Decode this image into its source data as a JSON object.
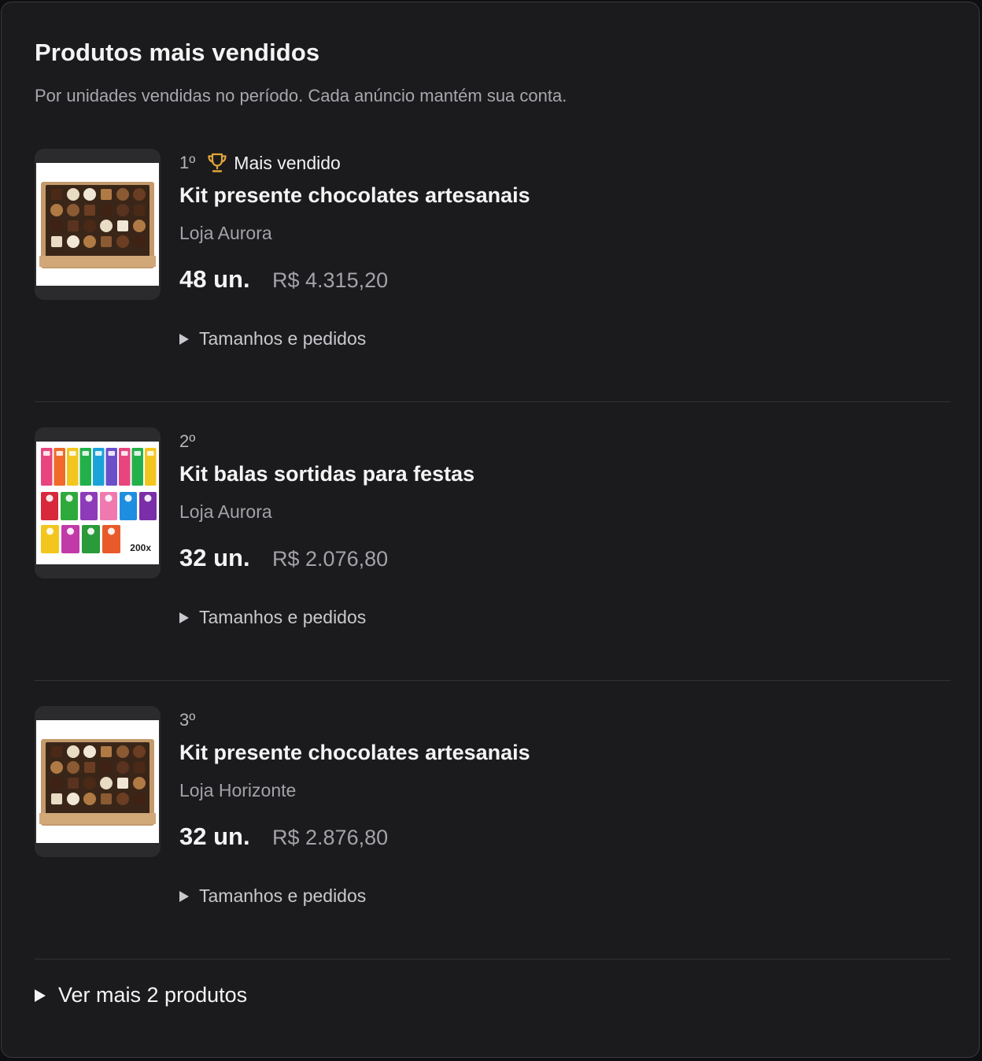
{
  "header": {
    "title": "Produtos mais vendidos",
    "subtitle": "Por unidades vendidas no período. Cada anúncio mantém sua conta."
  },
  "products": [
    {
      "rank": "1º",
      "badge": "Mais vendido",
      "badge_icon": "trophy-icon",
      "name": "Kit presente chocolates artesanais",
      "store": "Loja Aurora",
      "units": "48 un.",
      "revenue": "R$ 4.315,20",
      "details_label": "Tamanhos e pedidos",
      "image": "chocolate-box"
    },
    {
      "rank": "2º",
      "name": "Kit balas sortidas para festas",
      "store": "Loja Aurora",
      "units": "32 un.",
      "revenue": "R$ 2.076,80",
      "details_label": "Tamanhos e pedidos",
      "image": "candy-assortment",
      "image_text": "200x"
    },
    {
      "rank": "3º",
      "name": "Kit presente chocolates artesanais",
      "store": "Loja Horizonte",
      "units": "32 un.",
      "revenue": "R$ 2.876,80",
      "details_label": "Tamanhos e pedidos",
      "image": "chocolate-box"
    }
  ],
  "footer": {
    "more_label": "Ver mais 2 produtos"
  },
  "colors": {
    "card_background": "#1b1b1d",
    "text_primary": "#f4f4f5",
    "text_secondary": "#a2a2a8",
    "trophy": "#e0a43a",
    "divider": "#333337"
  }
}
